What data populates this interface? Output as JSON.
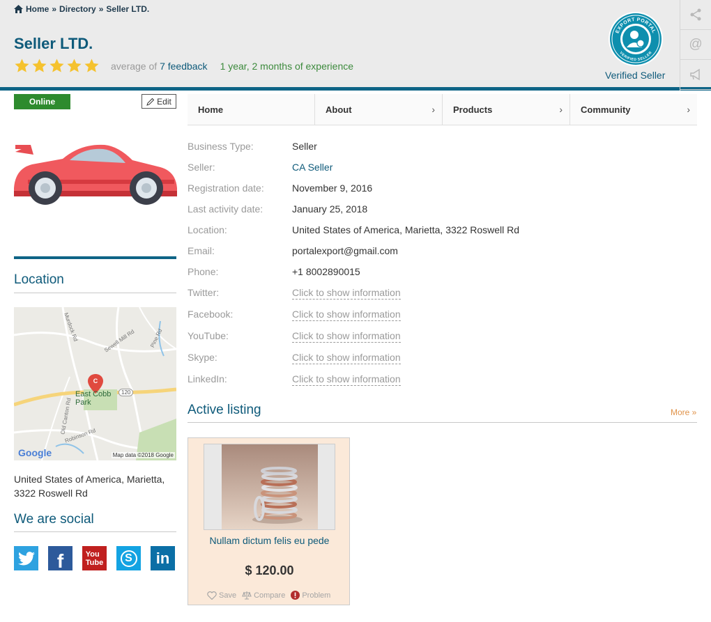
{
  "breadcrumb": {
    "home": "Home",
    "sep1": "»",
    "directory": "Directory",
    "sep2": "»",
    "current": "Seller LTD."
  },
  "seller": {
    "name": "Seller LTD.",
    "rating": 5,
    "average_prefix": "average of",
    "feedback_link": "7 feedback",
    "experience": "1 year, 2 months of experience",
    "verified_label": "Verified Seller",
    "badge_text_top": "EXPORT PORTAL",
    "badge_text_bottom": "VERIFIED SELLER"
  },
  "side_tools": [
    "share-icon",
    "at-icon",
    "megaphone-icon"
  ],
  "status": {
    "online": "Online",
    "edit": "Edit"
  },
  "tabs": [
    {
      "label": "Home",
      "chevron": ""
    },
    {
      "label": "About",
      "chevron": "›"
    },
    {
      "label": "Products",
      "chevron": "›"
    },
    {
      "label": "Community",
      "chevron": "›"
    }
  ],
  "info": [
    {
      "label": "Business Type:",
      "value": "Seller",
      "kind": "text"
    },
    {
      "label": "Seller:",
      "value": "CA Seller",
      "kind": "link"
    },
    {
      "label": "Registration date:",
      "value": "November 9, 2016",
      "kind": "text"
    },
    {
      "label": "Last activity date:",
      "value": "January 25, 2018",
      "kind": "text"
    },
    {
      "label": "Location:",
      "value": "United States of America, Marietta, 3322 Roswell Rd",
      "kind": "text"
    },
    {
      "label": "Email:",
      "value": "portalexport@gmail.com",
      "kind": "text"
    },
    {
      "label": "Phone:",
      "value": "+1 8002890015",
      "kind": "text"
    },
    {
      "label": "Twitter:",
      "value": "Click to show information",
      "kind": "hidden"
    },
    {
      "label": "Facebook:",
      "value": "Click to show information",
      "kind": "hidden"
    },
    {
      "label": "YouTube:",
      "value": "Click to show information",
      "kind": "hidden"
    },
    {
      "label": "Skype:",
      "value": "Click to show information",
      "kind": "hidden"
    },
    {
      "label": "LinkedIn:",
      "value": "Click to show information",
      "kind": "hidden"
    }
  ],
  "location": {
    "title": "Location",
    "map_place": "East Cobb Park",
    "map_roads": [
      "Murdock Rd",
      "Sewell Mill Rd",
      "Pine Rd",
      "Old Canton Rd",
      "Robinson Rd"
    ],
    "route_shield": "120",
    "map_pin_letter": "C",
    "map_logo": "Google",
    "map_credit": "Map data ©2018 Google",
    "address_line1": "United States of America, Marietta,",
    "address_line2": "3322 Roswell Rd"
  },
  "social": {
    "title": "We are social",
    "items": [
      {
        "name": "twitter",
        "glyph": "🐦",
        "color": "#2ea2e0"
      },
      {
        "name": "facebook",
        "glyph": "f",
        "color": "#2d5a9b"
      },
      {
        "name": "youtube",
        "glyph": "You Tube",
        "color": "#c0201f"
      },
      {
        "name": "skype",
        "glyph": "S",
        "color": "#13a3e2"
      },
      {
        "name": "linkedin",
        "glyph": "in",
        "color": "#0b6fa6"
      }
    ]
  },
  "active": {
    "title": "Active listing",
    "more": "More »",
    "card": {
      "name": "Nullam dictum felis eu pede",
      "price": "$ 120.00",
      "save": "Save",
      "compare": "Compare",
      "problem": "Problem"
    }
  },
  "colors": {
    "brand": "#0e5a7a",
    "online": "#2e8b2e",
    "star": "#f5c22e",
    "experience": "#3c8a3c",
    "more": "#e0934a"
  }
}
